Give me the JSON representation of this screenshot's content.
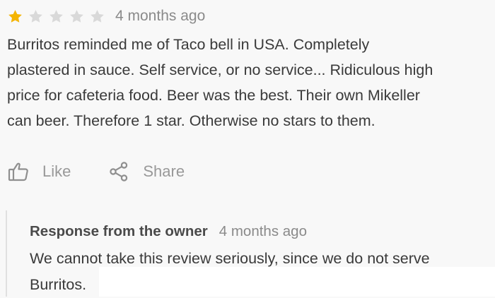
{
  "review": {
    "rating": 1,
    "rating_max": 5,
    "colors": {
      "star_filled": "#f4b400",
      "star_empty": "#d9d9d9",
      "muted_text": "#8a8a8a"
    },
    "time": "4 months ago",
    "text": "Burritos reminded me of Taco bell in USA. Completely\nplastered in sauce. Self service, or no service... Ridiculous high\nprice for cafeteria food. Beer was the best. Their own Mikeller\ncan beer. Therefore 1 star. Otherwise no stars to them."
  },
  "actions": {
    "like": {
      "label": "Like",
      "icon": "thumbs-up-icon"
    },
    "share": {
      "label": "Share",
      "icon": "share-icon"
    }
  },
  "owner_response": {
    "title": "Response from the owner",
    "time": "4 months ago",
    "text": "We cannot take this review seriously, since we do not serve Burritos."
  }
}
